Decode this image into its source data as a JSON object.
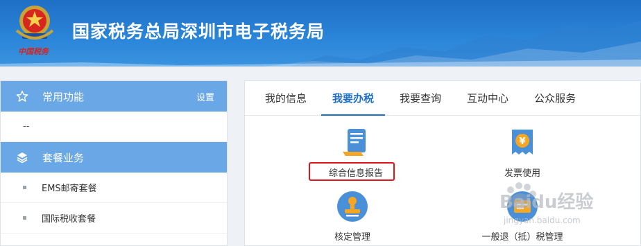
{
  "header": {
    "title": "国家税务总局深圳市电子税务局",
    "brand_script": "中国税务",
    "emblem_icon": "tax-emblem-icon"
  },
  "sidebar": {
    "sections": [
      {
        "icon": "star-icon",
        "label": "常用功能",
        "action": "设置"
      },
      {
        "icon": "layers-icon",
        "label": "套餐业务"
      }
    ],
    "common_items": [
      "--"
    ],
    "package_items": [
      {
        "label": "EMS邮寄套餐"
      },
      {
        "label": "国际税收套餐"
      }
    ]
  },
  "main": {
    "tabs": [
      {
        "label": "我的信息",
        "active": false
      },
      {
        "label": "我要办税",
        "active": true
      },
      {
        "label": "我要查询",
        "active": false
      },
      {
        "label": "互动中心",
        "active": false
      },
      {
        "label": "公众服务",
        "active": false
      }
    ],
    "functions": [
      {
        "label": "综合信息报告",
        "icon": "document-report-icon",
        "highlighted": true
      },
      {
        "label": "发票使用",
        "icon": "invoice-yen-icon"
      },
      {
        "label": "核定管理",
        "icon": "stamp-icon"
      },
      {
        "label": "一般退（抵）税管理",
        "icon": "tax-refund-icon"
      }
    ]
  },
  "colors": {
    "banner": "#1f6fc6",
    "sidebar_section": "#6aa7e6",
    "tab_active": "#1f6fc6",
    "highlight_border": "#e0141b"
  },
  "watermark": {
    "text": "Baidu经验",
    "url_text": "jingyan.baidu.com"
  }
}
